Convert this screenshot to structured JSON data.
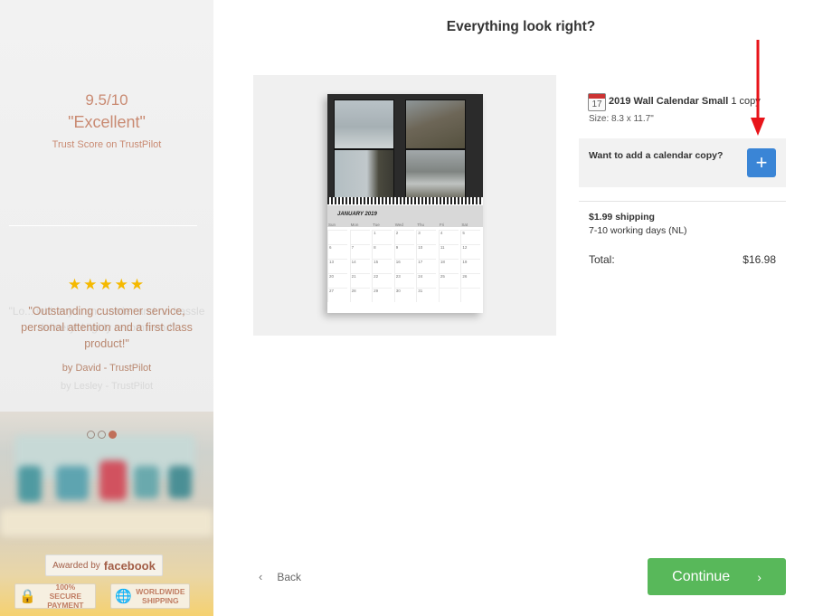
{
  "sidebar": {
    "score": "9.5/10",
    "score_word": "\"Excellent\"",
    "score_source": "Trust Score on TrustPilot",
    "stars": "★★★★★",
    "ghost_quote": "\"Lo... with my... on... order and no hassle delivery! Highly recommend\"",
    "ghost_author": "by Lesley - TrustPilot",
    "quote": "\"Outstanding customer service, personal attention and a first class product!\"",
    "quote_author": "by David - TrustPilot",
    "carousel_active_index": 2,
    "badge_awarded_small": "Awarded by",
    "badge_awarded_big": "facebook",
    "badge_secure": "100% SECURE PAYMENT",
    "badge_shipping": "WORLDWIDE SHIPPING"
  },
  "main": {
    "title": "Everything look right?"
  },
  "preview": {
    "month_label": "JANUARY 2019",
    "days": [
      "Sun",
      "Mon",
      "Tue",
      "Wed",
      "Thu",
      "Fri",
      "Sat"
    ],
    "dates": [
      "",
      "",
      "1",
      "2",
      "3",
      "4",
      "5",
      "6",
      "7",
      "8",
      "9",
      "10",
      "11",
      "12",
      "13",
      "14",
      "15",
      "16",
      "17",
      "18",
      "19",
      "20",
      "21",
      "22",
      "23",
      "24",
      "25",
      "26",
      "27",
      "28",
      "29",
      "30",
      "31",
      "",
      ""
    ]
  },
  "summary": {
    "calendar_icon_number": "17",
    "product_name": "2019 Wall Calendar Small",
    "product_qty": "1 copy",
    "size": "Size: 8.3 x 11.7\"",
    "add_copy_label": "Want to add a calendar copy?",
    "add_copy_button": "+",
    "shipping_price": "$1.99 shipping",
    "shipping_days": "7-10 working days (NL)",
    "total_label": "Total:",
    "total_value": "$16.98"
  },
  "footer": {
    "back_icon": "‹",
    "back_label": "Back",
    "continue_label": "Continue",
    "continue_icon": "›"
  },
  "colors": {
    "accent_brand": "#c98a72",
    "continue_green": "#58b85a",
    "add_blue": "#3a85d6",
    "arrow_red": "#e8141a",
    "star_gold": "#f5b900"
  }
}
